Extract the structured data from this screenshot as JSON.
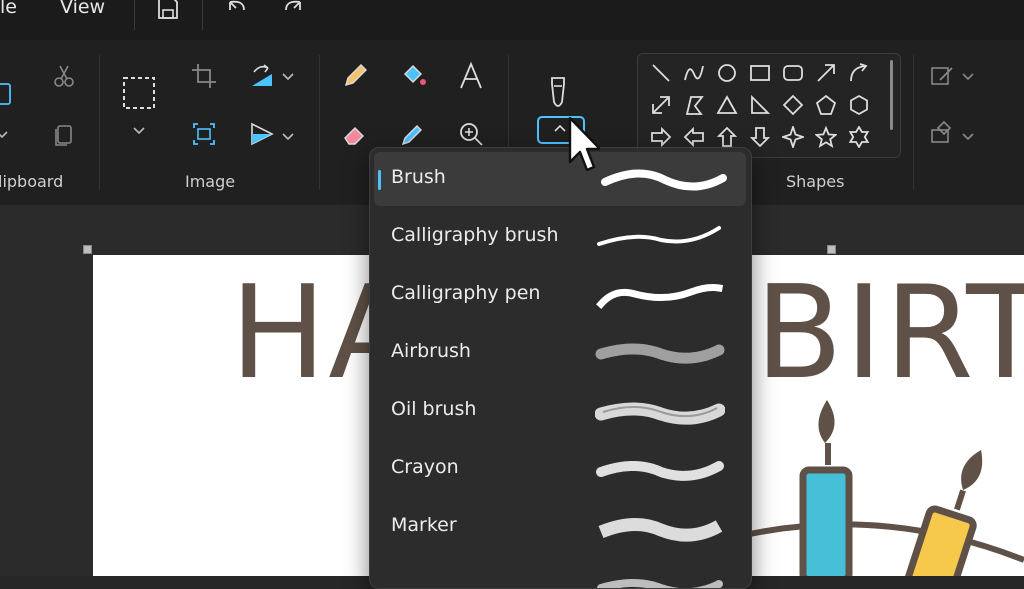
{
  "menu": {
    "file_partial": "le",
    "view": "View"
  },
  "ribbon": {
    "groups": {
      "clipboard": "lipboard",
      "image": "Image",
      "shapes": "Shapes"
    }
  },
  "brush_menu": {
    "items": [
      {
        "label": "Brush",
        "selected": true
      },
      {
        "label": "Calligraphy brush"
      },
      {
        "label": "Calligraphy pen"
      },
      {
        "label": "Airbrush"
      },
      {
        "label": "Oil brush"
      },
      {
        "label": "Crayon"
      },
      {
        "label": "Marker"
      }
    ]
  },
  "canvas": {
    "text_left": "HA",
    "text_right": "BIRT"
  },
  "colors": {
    "accent": "#4cc2ff",
    "canvas_text": "#5f5147",
    "candle_blue": "#45c0d6",
    "candle_yellow": "#f6c94c"
  }
}
